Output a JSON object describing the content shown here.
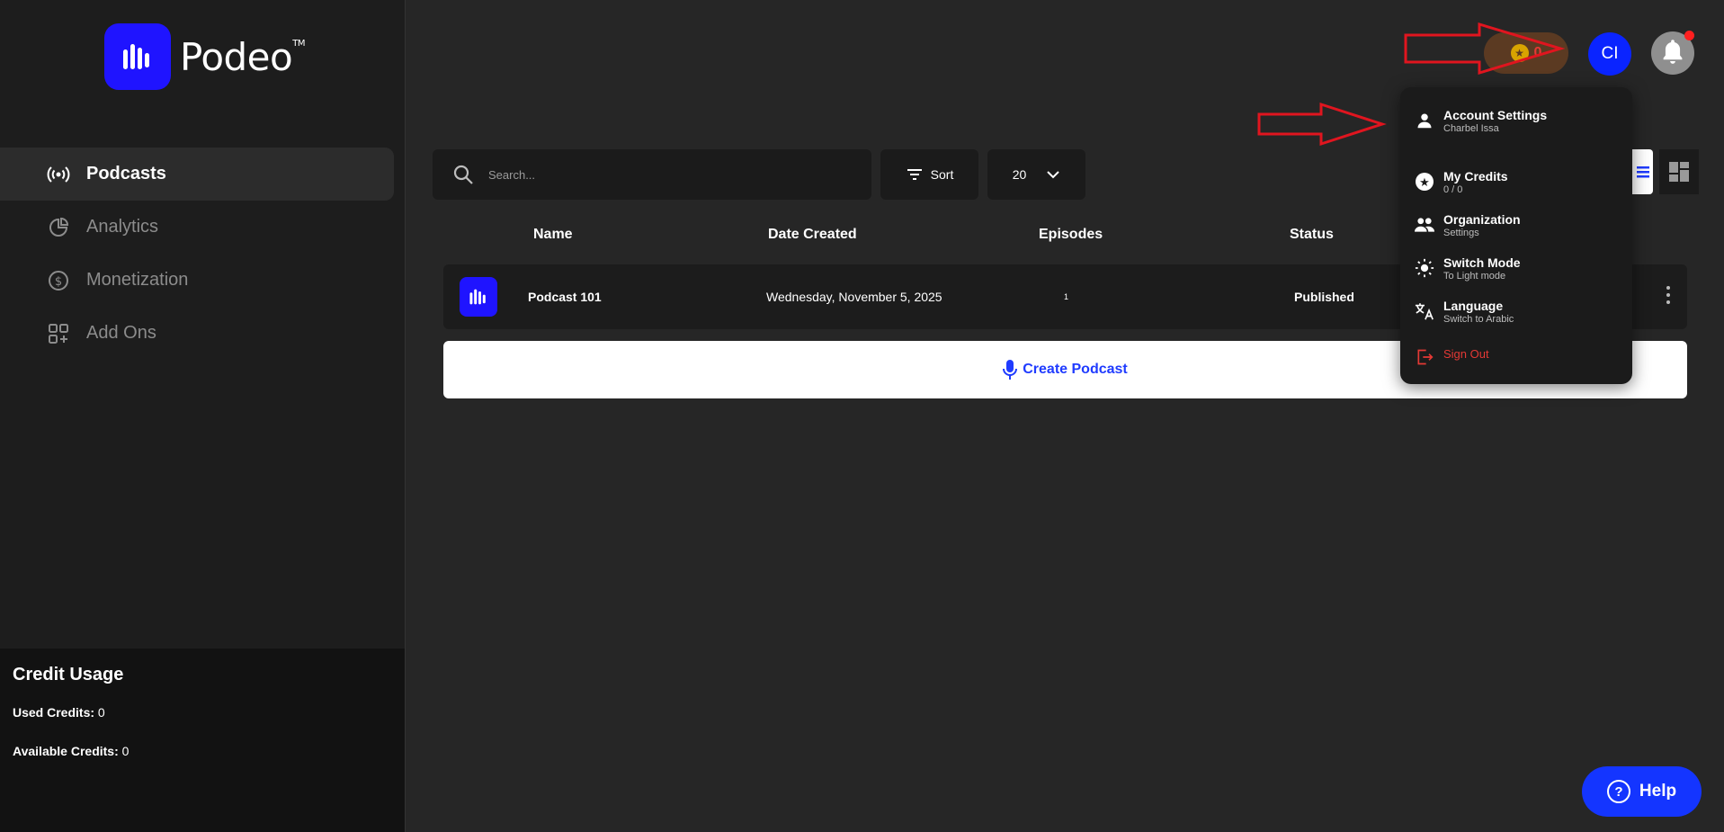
{
  "brand": {
    "name": "Podeo",
    "tm": "TM"
  },
  "sidebar": {
    "items": [
      {
        "label": "Podcasts",
        "icon": "broadcast-icon",
        "active": true
      },
      {
        "label": "Analytics",
        "icon": "pie-chart-icon"
      },
      {
        "label": "Monetization",
        "icon": "dollar-icon"
      },
      {
        "label": "Add Ons",
        "icon": "grid-plus-icon"
      }
    ]
  },
  "credit_usage": {
    "title": "Credit Usage",
    "used_label": "Used Credits:",
    "used_value": "0",
    "available_label": "Available Credits:",
    "available_value": "0"
  },
  "topbar": {
    "coin_value": "0",
    "avatar_initials": "CI"
  },
  "toolbar": {
    "search_placeholder": "Search...",
    "sort_label": "Sort",
    "per_page": "20"
  },
  "table": {
    "headers": {
      "name": "Name",
      "date": "Date Created",
      "episodes": "Episodes",
      "status": "Status"
    },
    "rows": [
      {
        "name": "Podcast 101",
        "date": "Wednesday, November 5, 2025",
        "episodes": "1",
        "status": "Published"
      }
    ]
  },
  "create_button": "Create Podcast",
  "menu": {
    "account": {
      "title": "Account Settings",
      "sub": "Charbel Issa"
    },
    "credits": {
      "title": "My Credits",
      "sub": "0 / 0"
    },
    "organization": {
      "title": "Organization",
      "sub": "Settings"
    },
    "switch_mode": {
      "title": "Switch Mode",
      "sub": "To Light mode"
    },
    "language": {
      "title": "Language",
      "sub": "Switch to Arabic"
    },
    "sign_out": "Sign Out"
  },
  "help_label": "Help",
  "colors": {
    "brand_blue": "#1f14ff",
    "accent_red": "#e53935",
    "annotation_red": "#e0151f"
  }
}
